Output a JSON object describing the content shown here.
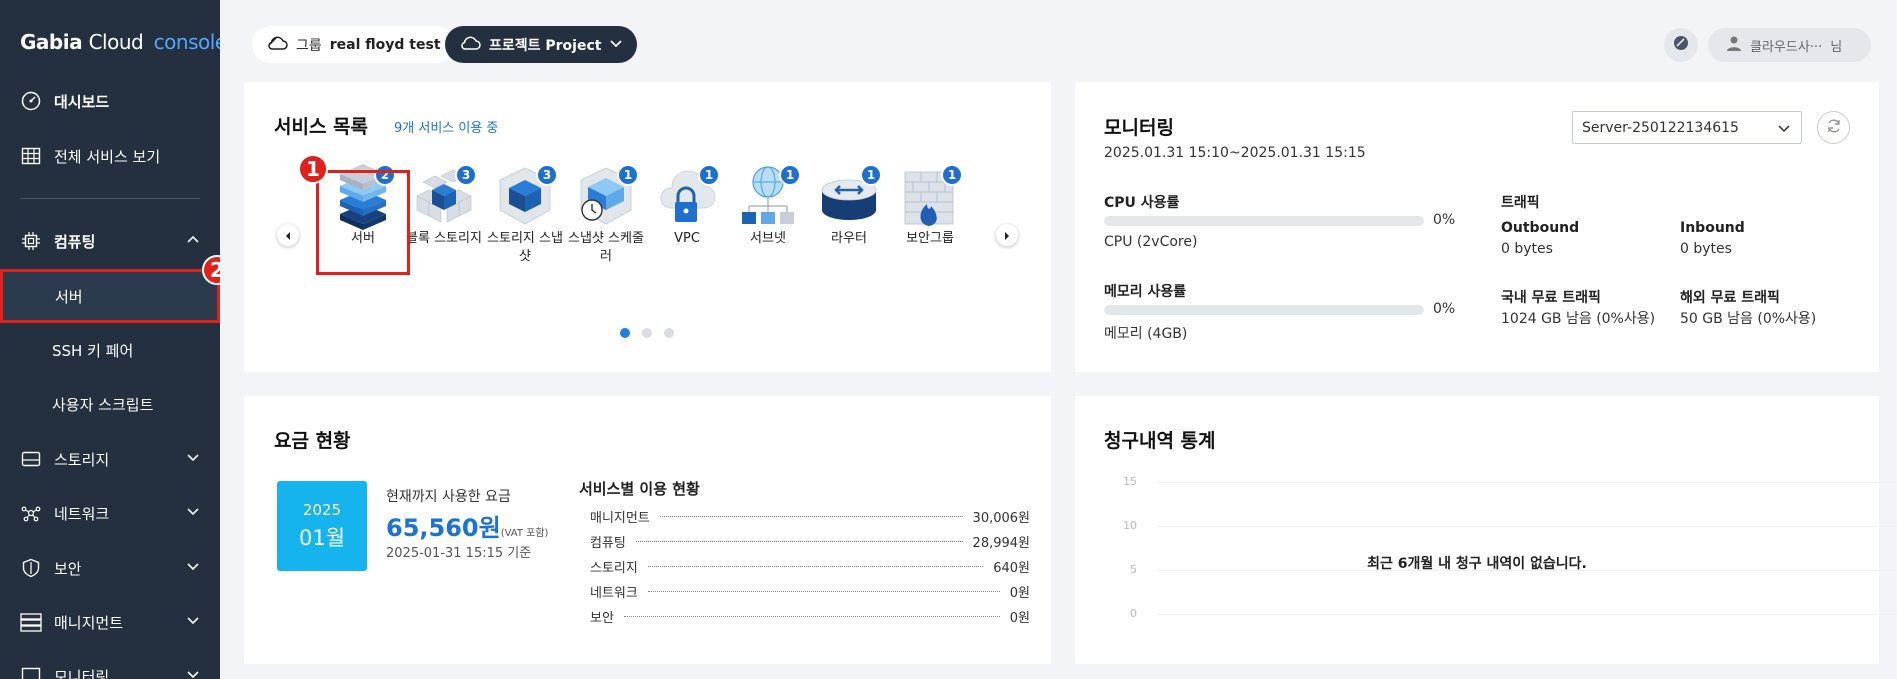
{
  "app": {
    "logo_brand": "Gabia",
    "logo_cloud": "Cloud",
    "logo_console": "console"
  },
  "sidebar": {
    "dashboard": "대시보드",
    "all_services": "전체 서비스 보기",
    "computing": "컴퓨팅",
    "computing_sub": [
      "서버",
      "SSH 키 페어",
      "사용자 스크립트"
    ],
    "storage": "스토리지",
    "network": "네트워크",
    "security": "보안",
    "management": "매니지먼트",
    "monitoring": "모니터링"
  },
  "topbar": {
    "group_label": "그룹",
    "group_value": "real floyd test",
    "project_value": "프로젝트 Project",
    "user_name": "클라우드사···",
    "user_suffix": "님"
  },
  "services": {
    "title": "서비스 목록",
    "count_text": "9개 서비스 이용 중",
    "items": [
      {
        "label": "서버",
        "count": "2"
      },
      {
        "label": "블록 스토리지",
        "count": "3"
      },
      {
        "label": "스토리지 스냅샷",
        "count": "3"
      },
      {
        "label": "스냅샷 스케줄러",
        "count": "1"
      },
      {
        "label": "VPC",
        "count": "1"
      },
      {
        "label": "서브넷",
        "count": "1"
      },
      {
        "label": "라우터",
        "count": "1"
      },
      {
        "label": "보안그룹",
        "count": "1"
      }
    ],
    "pages": 3,
    "current_page": 1,
    "callout_1": "1",
    "callout_2": "2"
  },
  "monitoring": {
    "title": "모니터링",
    "range": "2025.01.31 15:10~2025.01.31 15:15",
    "server_select": "Server-250122134615",
    "cpu_label": "CPU 사용률",
    "cpu_pct": "0%",
    "cpu_usage_fraction": 0,
    "cpu_spec": "CPU (2vCore)",
    "mem_label": "메모리 사용률",
    "mem_pct": "0%",
    "mem_usage_fraction": 0,
    "mem_spec": "메모리 (4GB)",
    "traffic_label": "트래픽",
    "outbound_label": "Outbound",
    "outbound_value": "0 bytes",
    "inbound_label": "Inbound",
    "inbound_value": "0 bytes",
    "domestic_label": "국내 무료 트래픽",
    "domestic_value": "1024 GB 남음 (0%사용)",
    "overseas_label": "해외 무료 트래픽",
    "overseas_value": "50 GB 남음 (0%사용)"
  },
  "billing": {
    "title": "요금 현황",
    "year": "2025",
    "month": "01월",
    "used_label": "현재까지 사용한 요금",
    "amount": "65,560원",
    "vat": "(VAT 포함)",
    "as_of": "2025-01-31 15:15 기준",
    "by_service_title": "서비스별 이용 현황",
    "rows": [
      {
        "name": "매니지먼트",
        "value": "30,006원"
      },
      {
        "name": "컴퓨팅",
        "value": "28,994원"
      },
      {
        "name": "스토리지",
        "value": "640원"
      },
      {
        "name": "네트워크",
        "value": "0원"
      },
      {
        "name": "보안",
        "value": "0원"
      }
    ]
  },
  "invoice": {
    "title": "청구내역 통계",
    "empty_message": "최근 6개월 내 청구 내역이 없습니다.",
    "y_ticks": [
      "15",
      "10",
      "5",
      "0"
    ]
  }
}
